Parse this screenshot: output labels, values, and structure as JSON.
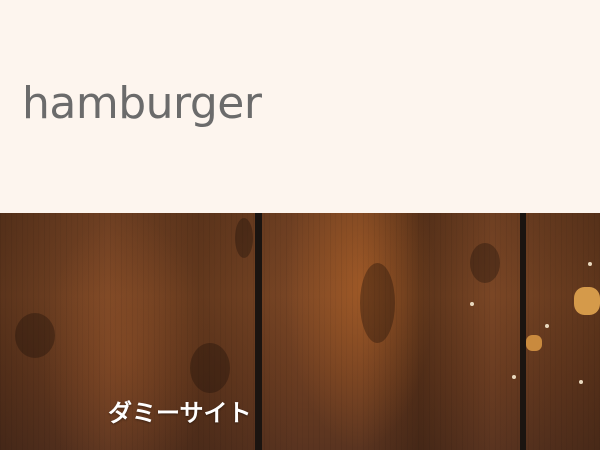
{
  "header": {
    "site_title": "hamburger"
  },
  "hero": {
    "label": "ダミーサイト",
    "background": "wood-planks"
  },
  "colors": {
    "header_background": "#fdf5ee",
    "title_text": "#6b6b6b",
    "hero_label_text": "#ffffff",
    "wood": "#6e3f22"
  }
}
